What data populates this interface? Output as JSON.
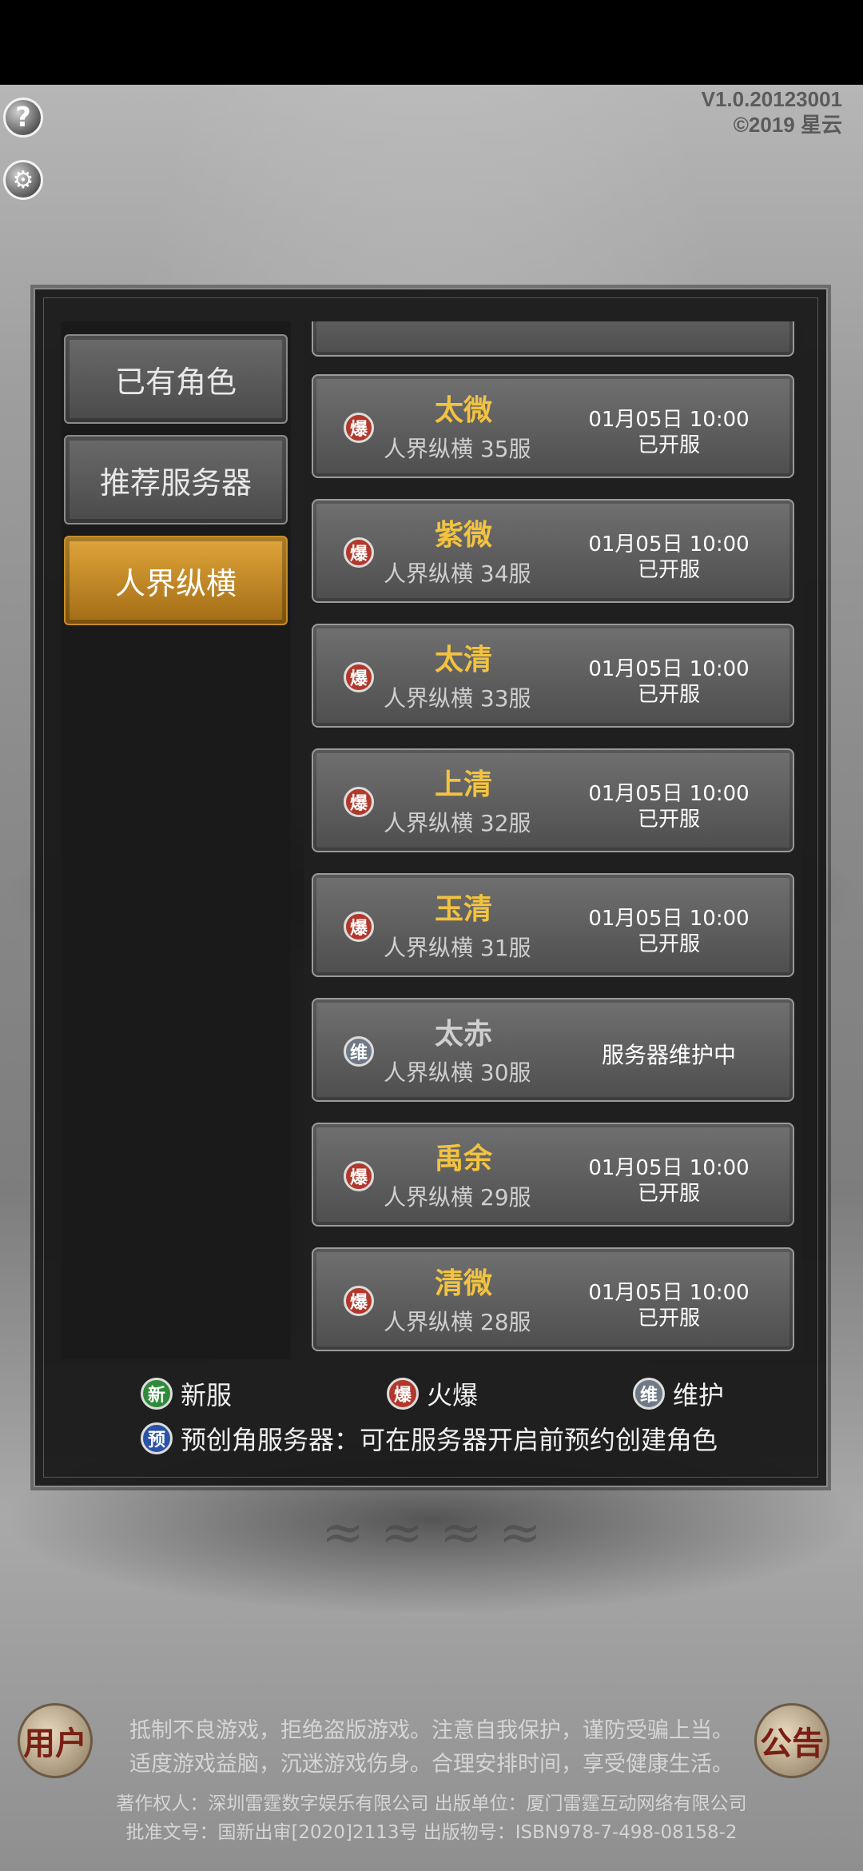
{
  "header": {
    "version": "V1.0.20123001",
    "copyright": "©2019 星云"
  },
  "icons": {
    "help": "?",
    "settings": "⚙"
  },
  "tabs": [
    {
      "label": "已有角色"
    },
    {
      "label": "推荐服务器"
    },
    {
      "label": "人界纵横"
    }
  ],
  "servers": [
    {
      "name": "太微",
      "sub": "人界纵横 35服",
      "time": "01月05日 10:00",
      "status": "已开服",
      "badge": "爆"
    },
    {
      "name": "紫微",
      "sub": "人界纵横 34服",
      "time": "01月05日 10:00",
      "status": "已开服",
      "badge": "爆"
    },
    {
      "name": "太清",
      "sub": "人界纵横 33服",
      "time": "01月05日 10:00",
      "status": "已开服",
      "badge": "爆"
    },
    {
      "name": "上清",
      "sub": "人界纵横 32服",
      "time": "01月05日 10:00",
      "status": "已开服",
      "badge": "爆"
    },
    {
      "name": "玉清",
      "sub": "人界纵横 31服",
      "time": "01月05日 10:00",
      "status": "已开服",
      "badge": "爆"
    },
    {
      "name": "太赤",
      "sub": "人界纵横 30服",
      "status_single": "服务器维护中",
      "badge": "维"
    },
    {
      "name": "禹余",
      "sub": "人界纵横 29服",
      "time": "01月05日 10:00",
      "status": "已开服",
      "badge": "爆"
    },
    {
      "name": "清微",
      "sub": "人界纵横 28服",
      "time": "01月05日 10:00",
      "status": "已开服",
      "badge": "爆"
    }
  ],
  "legend": {
    "new_badge": "新",
    "new_label": "新服",
    "hot_badge": "爆",
    "hot_label": "火爆",
    "maint_badge": "维",
    "maint_label": "维护",
    "pre_badge": "预",
    "pre_label": "预创角服务器：可在服务器开启前预约创建角色"
  },
  "corner": {
    "left": "用户",
    "right": "公告"
  },
  "footer": {
    "line1": "抵制不良游戏，拒绝盗版游戏。注意自我保护，谨防受骗上当。",
    "line2": "适度游戏益脑，沉迷游戏伤身。合理安排时间，享受健康生活。",
    "line3": "著作权人：深圳雷霆数字娱乐有限公司 出版单位：厦门雷霆互动网络有限公司",
    "line4": "批准文号：国新出审[2020]2113号 出版物号：ISBN978-7-498-08158-2"
  }
}
